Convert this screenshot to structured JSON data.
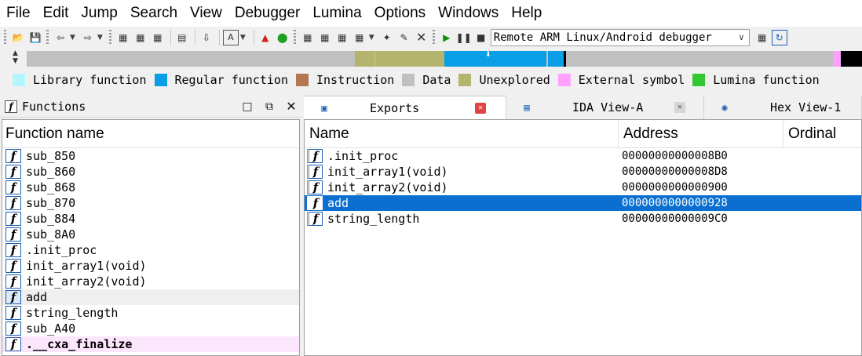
{
  "menu": [
    "File",
    "Edit",
    "Jump",
    "Search",
    "View",
    "Debugger",
    "Lumina",
    "Options",
    "Windows",
    "Help"
  ],
  "toolbar": {
    "debugger": "Remote ARM Linux/Android debugger"
  },
  "legend": [
    {
      "label": "Library function",
      "color": "#b4f5ff"
    },
    {
      "label": "Regular function",
      "color": "#0a9ee6"
    },
    {
      "label": "Instruction",
      "color": "#b47850"
    },
    {
      "label": "Data",
      "color": "#c0c0c0"
    },
    {
      "label": "Unexplored",
      "color": "#b4b46e"
    },
    {
      "label": "External symbol",
      "color": "#ffa0ff"
    },
    {
      "label": "Lumina function",
      "color": "#32c832"
    }
  ],
  "functions_panel": {
    "title": "Functions",
    "column": "Function name",
    "rows": [
      "sub_850",
      "sub_860",
      "sub_868",
      "sub_870",
      "sub_884",
      "sub_8A0",
      ".init_proc",
      "init_array1(void)",
      "init_array2(void)",
      "add",
      "string_length",
      "sub_A40",
      ".__cxa_finalize"
    ]
  },
  "tabs": [
    "Exports",
    "IDA View-A",
    "Hex View-1"
  ],
  "exports": {
    "columns": [
      "Name",
      "Address",
      "Ordinal"
    ],
    "rows": [
      {
        "name": ".init_proc",
        "address": "00000000000008B0"
      },
      {
        "name": "init_array1(void)",
        "address": "00000000000008D8"
      },
      {
        "name": "init_array2(void)",
        "address": "0000000000000900"
      },
      {
        "name": "add",
        "address": "0000000000000928"
      },
      {
        "name": "string_length",
        "address": "00000000000009C0"
      }
    ]
  }
}
